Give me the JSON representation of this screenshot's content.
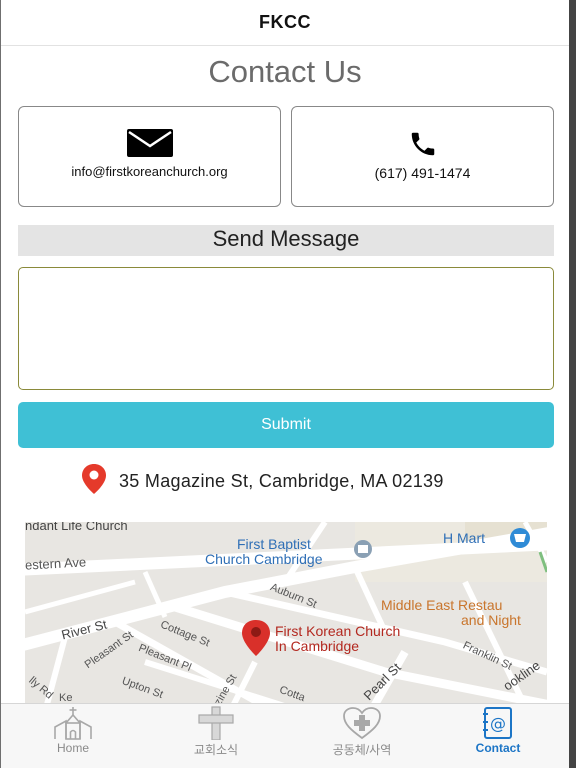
{
  "app": {
    "title": "FKCC"
  },
  "page": {
    "heading": "Contact Us"
  },
  "contact": {
    "email": "info@firstkoreanchurch.org",
    "phone": "(617) 491-1474"
  },
  "message": {
    "section_title": "Send Message",
    "input_value": "",
    "submit_label": "Submit"
  },
  "location": {
    "address": "35 Magazine St, Cambridge, MA 02139"
  },
  "map": {
    "labels": {
      "abundant_life": "ndant Life Church",
      "first_baptist_1": "First Baptist",
      "first_baptist_2": "Church Cambridge",
      "hmart": "H Mart",
      "western_ave": "estern Ave",
      "auburn": "Auburn St",
      "middle_east_1": "Middle East Restau",
      "middle_east_2": "and Night",
      "river_st": "River St",
      "cottage_st": "Cottage St",
      "fkc_1": "First Korean Church",
      "fkc_2": "In Cambridge",
      "franklin": "Franklin St",
      "pleasant_st": "Pleasant St",
      "pleasant_pl": "Pleasant Pl",
      "upton": "Upton St",
      "magazine": "zine St",
      "cotta": "Cotta",
      "pearl": "Pearl St",
      "brookline": "ookline",
      "lly_rd": "lly Rd",
      "ke": "Ke"
    }
  },
  "tabs": [
    {
      "label": "Home",
      "icon": "church-icon"
    },
    {
      "label": "교회소식",
      "icon": "cross-icon"
    },
    {
      "label": "공동체/사역",
      "icon": "heart-cross-icon"
    },
    {
      "label": "Contact",
      "icon": "contact-book-icon"
    }
  ],
  "colors": {
    "accent": "#3fc0d5",
    "active_tab": "#1c75c6",
    "pin": "#e53a2b",
    "map_poi": "#b34a3e",
    "map_blue": "#2f6fb6",
    "map_orange": "#c9752c"
  }
}
